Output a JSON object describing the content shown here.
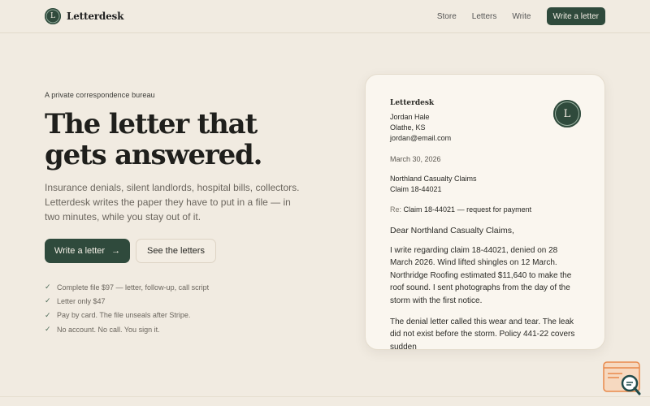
{
  "header": {
    "logo_letter": "L",
    "brand": "Letterdesk",
    "nav": [
      "Store",
      "Letters",
      "Write"
    ],
    "cta": "Write a letter"
  },
  "hero": {
    "eyebrow": "A private correspondence bureau",
    "headline_1": "The letter that",
    "headline_2": "gets answered.",
    "subhead": "Insurance denials, silent landlords, hospital bills, collectors. Letterdesk writes the paper they have to put in a file — in two minutes, while you stay out of it.",
    "primary_button": "Write a letter",
    "primary_icon": "→",
    "secondary_button": "See the letters",
    "checks": [
      "Complete file $97 — letter, follow-up, call script",
      "Letter only $47",
      "Pay by card. The file unseals after Stripe.",
      "No account. No call. You sign it."
    ],
    "check_glyph": "✓"
  },
  "letter": {
    "brand": "Letterdesk",
    "seal_letter": "L",
    "sender": [
      "Jordan Hale",
      "Olathe, KS",
      "jordan@email.com"
    ],
    "date": "March 30, 2026",
    "recipient": [
      "Northland Casualty Claims",
      "Claim 18-44021"
    ],
    "re_label": "Re:",
    "re_text": "Claim 18-44021 — request for payment",
    "salutation": "Dear Northland Casualty Claims,",
    "paragraph_1": "I write regarding claim 18-44021, denied on 28 March 2026. Wind lifted shingles on 12 March. Northridge Roofing estimated $11,640 to make the roof sound. I sent photographs from the day of the storm with the first notice.",
    "paragraph_2": "The denial letter called this wear and tear. The leak did not exist before the storm. Policy 441-22 covers sudden"
  },
  "colors": {
    "background": "#f1ebe1",
    "accent": "#2f4a3c",
    "card": "#faf6ef"
  },
  "icons": [
    "logo-mark",
    "arrow-right-icon",
    "check-icon",
    "seal-icon",
    "search-widget-icon"
  ]
}
